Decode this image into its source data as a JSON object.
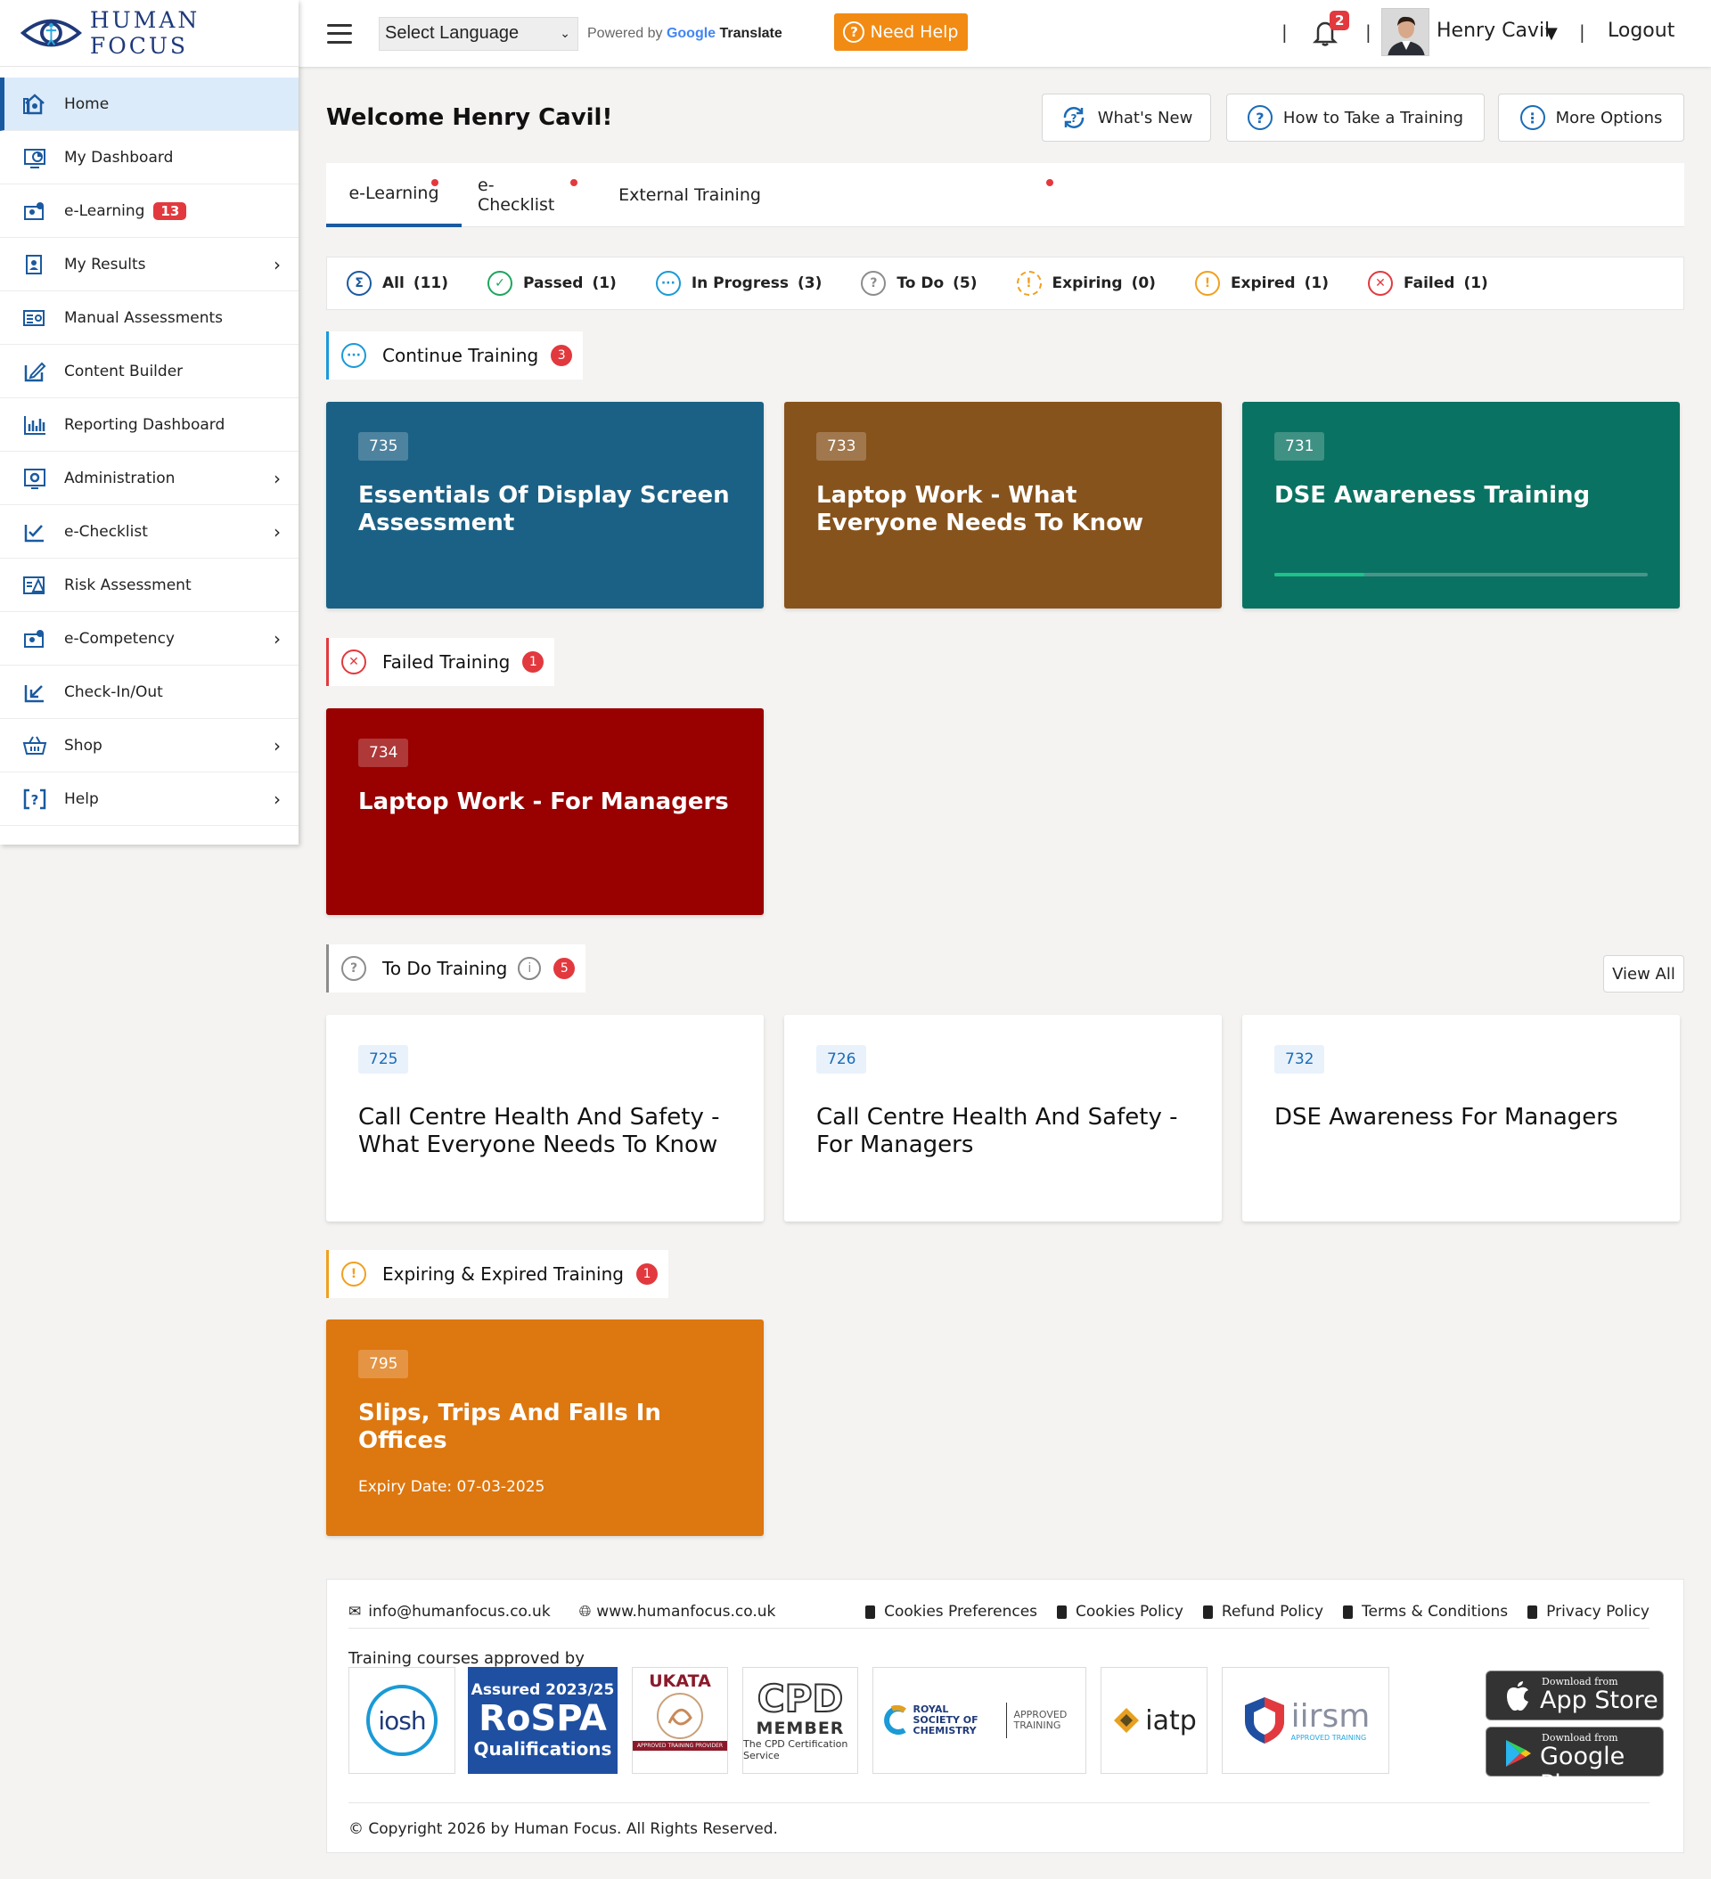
{
  "brand": {
    "name": "HUMAN FOCUS"
  },
  "topbar": {
    "language_select": "Select Language",
    "powered_by": "Powered by",
    "google": "Google",
    "translate": "Translate",
    "need_help": "Need Help",
    "notifications_count": "2",
    "user_name": "Henry Cavil",
    "logout": "Logout"
  },
  "sidebar": {
    "items": [
      {
        "label": "Home",
        "icon": "home-icon"
      },
      {
        "label": "My Dashboard",
        "icon": "dashboard-icon"
      },
      {
        "label": "e-Learning",
        "icon": "elearning-icon",
        "badge": "13"
      },
      {
        "label": "My Results",
        "icon": "results-icon"
      },
      {
        "label": "Manual Assessments",
        "icon": "assessment-icon"
      },
      {
        "label": "Content Builder",
        "icon": "edit-icon"
      },
      {
        "label": "Reporting Dashboard",
        "icon": "bar-chart-icon"
      },
      {
        "label": "Administration",
        "icon": "admin-gear-icon"
      },
      {
        "label": "e-Checklist",
        "icon": "checklist-icon"
      },
      {
        "label": "Risk Assessment",
        "icon": "risk-icon"
      },
      {
        "label": "e-Competency",
        "icon": "competency-icon"
      },
      {
        "label": "Check-In/Out",
        "icon": "checkin-icon"
      },
      {
        "label": "Shop",
        "icon": "basket-icon"
      },
      {
        "label": "Help",
        "icon": "help-icon"
      }
    ]
  },
  "main": {
    "welcome": "Welcome Henry Cavil!",
    "header_buttons": {
      "whats_new": "What's New",
      "how_to": "How to Take a Training",
      "more_options": "More Options"
    },
    "tabs": [
      {
        "label": "e-Learning"
      },
      {
        "label": "e-Checklist"
      },
      {
        "label": "External Training"
      }
    ],
    "filters": [
      {
        "label": "All",
        "count": "(11)"
      },
      {
        "label": "Passed",
        "count": "(1)"
      },
      {
        "label": "In Progress",
        "count": "(3)"
      },
      {
        "label": "To Do",
        "count": "(5)"
      },
      {
        "label": "Expiring",
        "count": "(0)"
      },
      {
        "label": "Expired",
        "count": "(1)"
      },
      {
        "label": "Failed",
        "count": "(1)"
      }
    ],
    "sections": {
      "continue": {
        "title": "Continue Training",
        "badge": "3",
        "cards": [
          {
            "code": "735",
            "title": "Essentials Of Display Screen Assessment",
            "color": "#1b6185"
          },
          {
            "code": "733",
            "title": "Laptop Work - What Everyone Needs To Know",
            "color": "#87531c"
          },
          {
            "code": "731",
            "title": "DSE Awareness Training",
            "color": "#0a7262",
            "progress": 0.24
          }
        ]
      },
      "failed": {
        "title": "Failed Training",
        "badge": "1",
        "cards": [
          {
            "code": "734",
            "title": "Laptop Work - For Managers",
            "color": "#990000"
          }
        ]
      },
      "todo": {
        "title": "To Do Training",
        "badge": "5",
        "view_all": "View All",
        "cards": [
          {
            "code": "725",
            "title": "Call Centre Health And Safety - What Everyone Needs To Know"
          },
          {
            "code": "726",
            "title": "Call Centre Health And Safety - For Managers"
          },
          {
            "code": "732",
            "title": "DSE Awareness For Managers"
          }
        ]
      },
      "expiring": {
        "title": "Expiring & Expired Training",
        "badge": "1",
        "cards": [
          {
            "code": "795",
            "title": "Slips, Trips And Falls In Offices",
            "expiry": "Expiry Date: 07-03-2025",
            "color": "#dd770f"
          }
        ]
      }
    }
  },
  "footer": {
    "email": "info@humanfocus.co.uk",
    "website": "www.humanfocus.co.uk",
    "links": [
      "Cookies Preferences",
      "Cookies Policy",
      "Refund Policy",
      "Terms & Conditions",
      "Privacy Policy"
    ],
    "approved_by": "Training courses approved by",
    "logos": {
      "iosh": "iosh",
      "rospa_line1": "Assured 2023/25",
      "rospa_line2": "RoSPA",
      "rospa_line3": "Qualifications",
      "ukata": "UKATA",
      "ukata_sub": "APPROVED TRAINING PROVIDER",
      "cpd_big": "CPD",
      "cpd_member": "MEMBER",
      "cpd_sub": "The CPD Certification Service",
      "rsc_left": "ROYAL SOCIETY OF CHEMISTRY",
      "rsc_right": "APPROVED TRAINING",
      "iatp": "iatp",
      "iirsm": "iirsm",
      "iirsm_sub": "APPROVED TRAINING"
    },
    "app_store_small": "Download from",
    "app_store": "App Store",
    "google_play_small": "Download from",
    "google_play": "Google Play",
    "copyright": "© Copyright 2026 by Human Focus. All Rights Reserved."
  }
}
